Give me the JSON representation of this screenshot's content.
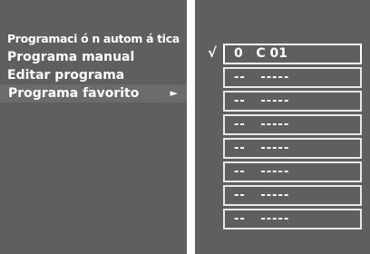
{
  "menu": {
    "items": [
      {
        "label": "Programaci ó n autom á tica"
      },
      {
        "label": "Programa manual"
      },
      {
        "label": "Editar programa"
      },
      {
        "label": "Programa favorito"
      }
    ],
    "arrow": "►"
  },
  "favorites": {
    "check": "√",
    "slots": [
      {
        "text": "0   C 01"
      },
      {
        "text": "--   -----"
      },
      {
        "text": "--   -----"
      },
      {
        "text": "--   -----"
      },
      {
        "text": "--   -----"
      },
      {
        "text": "--   -----"
      },
      {
        "text": "--   -----"
      },
      {
        "text": "--   -----"
      }
    ]
  },
  "colors": {
    "panel": "#5f5f5f",
    "text": "#ffffff",
    "background": "#ffffff"
  }
}
